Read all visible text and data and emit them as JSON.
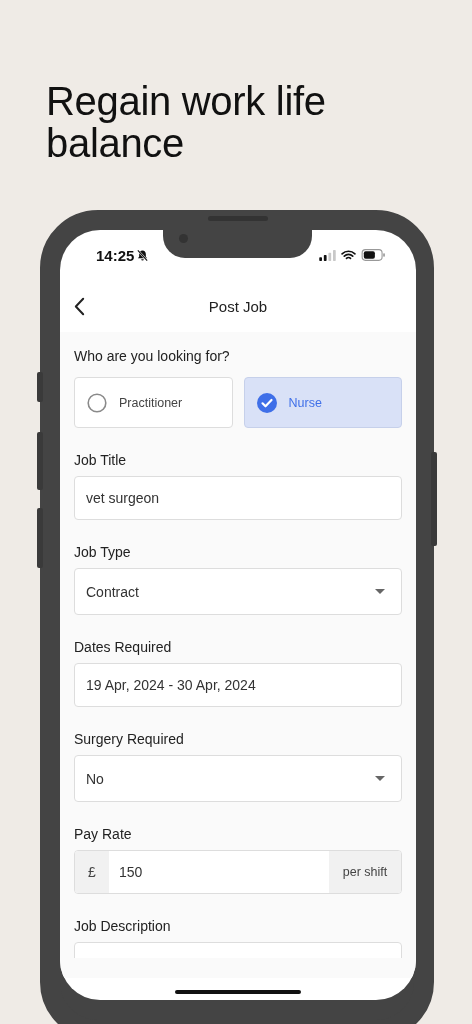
{
  "headline": "Regain work life balance",
  "status_bar": {
    "time": "14:25",
    "silent": true
  },
  "header": {
    "title": "Post Job"
  },
  "role_question": "Who are you looking for?",
  "roles": [
    {
      "label": "Practitioner",
      "selected": false
    },
    {
      "label": "Nurse",
      "selected": true
    }
  ],
  "fields": [
    {
      "kind": "text",
      "label": "Job Title",
      "value": "vet surgeon"
    },
    {
      "kind": "select",
      "label": "Job Type",
      "value": "Contract"
    },
    {
      "kind": "text",
      "label": "Dates Required",
      "value": "19 Apr, 2024 - 30 Apr, 2024"
    },
    {
      "kind": "select",
      "label": "Surgery Required",
      "value": "No"
    },
    {
      "kind": "currency",
      "label": "Pay Rate",
      "prefix": "£",
      "value": "150",
      "suffix": "per shift"
    },
    {
      "kind": "textarea",
      "label": "Job Description"
    }
  ]
}
